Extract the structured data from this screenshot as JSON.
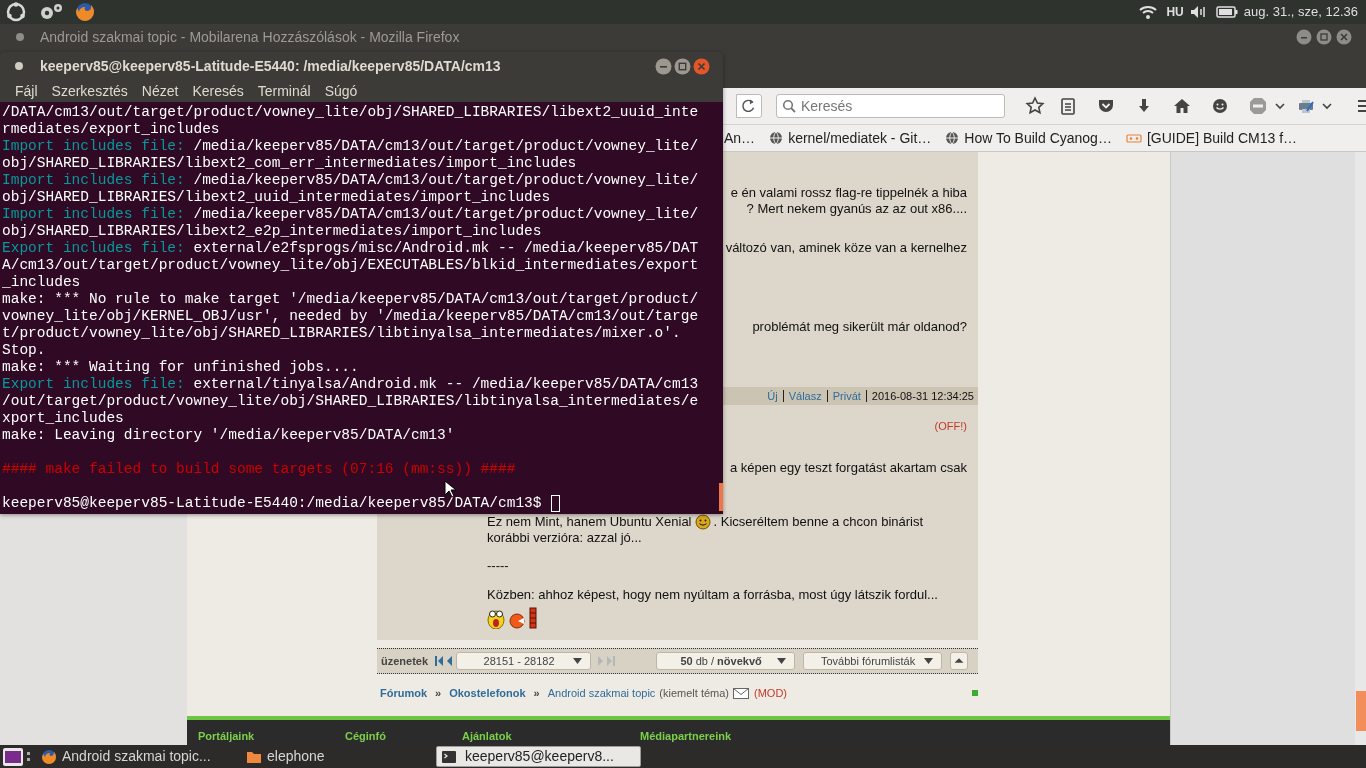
{
  "top_panel": {
    "keyboard_layout": "HU",
    "clock": "aug. 31., sze, 12.36"
  },
  "browser": {
    "title": "Android szakmai topic - Mobilarena Hozzászólások - Mozilla Firefox",
    "search": {
      "placeholder": "Keresés"
    },
    "bookmarks": [
      {
        "label": "An…",
        "kind": "plain"
      },
      {
        "label": "kernel/mediatek - Git…",
        "kind": "globe"
      },
      {
        "label": "How To Build Cyanog…",
        "kind": "globe"
      },
      {
        "label": "[GUIDE] Build CM13 f…",
        "kind": "xda"
      }
    ],
    "posts": [
      {
        "paragraphs": [
          [
            {
              "kind": "text",
              "text": "e én valami rossz flag-re tippelnék a hiba"
            },
            {
              "kind": "text",
              "text": "? Mert nekem gyanús az az out x86...."
            }
          ],
          [
            {
              "kind": "text",
              "text": "változó van, aminek köze van a kernelhez"
            }
          ],
          [
            {
              "kind": "text",
              "text": "problémát meg sikerült már oldanod?"
            }
          ]
        ],
        "footer": {
          "links": [
            "Új",
            "Válasz",
            "Privát"
          ],
          "timestamp": "2016-08-31 12:34:25"
        }
      },
      {
        "badge": "(OFF!)",
        "paragraphs": [
          [
            {
              "kind": "text",
              "text": "a képen egy teszt forgatást akartam csak"
            }
          ],
          [
            {
              "kind": "smiley_text",
              "before": "Ez nem Mint, hanem Ubuntu Xenial",
              "after": ". Kicseréltem benne a chcon binárist"
            },
            {
              "kind": "text",
              "text": "korábbi verzióra: azzal jó..."
            }
          ],
          [
            {
              "kind": "text",
              "text": "-----"
            }
          ],
          [
            {
              "kind": "text",
              "text": "Közben: ahhoz képest, hogy nem nyúltam a forrásba, most úgy látszik fordul..."
            },
            {
              "kind": "emojis"
            }
          ]
        ]
      }
    ],
    "pager": {
      "label": "üzenetek",
      "range": "28151 - 28182",
      "per_page": "**50** db / **növekvő**",
      "more": "További fórumlisták"
    },
    "breadcrumb": [
      {
        "kind": "section",
        "label": "Fórumok"
      },
      {
        "kind": "separator",
        "label": "»"
      },
      {
        "kind": "section",
        "label": "Okostelefonok"
      },
      {
        "kind": "separator",
        "label": "»"
      },
      {
        "kind": "topic",
        "label": "Android szakmai topic"
      },
      {
        "kind": "note",
        "label": "(kiemelt téma)"
      },
      {
        "kind": "mail"
      },
      {
        "kind": "mod",
        "label": "(MOD)"
      }
    ],
    "footer": [
      "Portáljaink",
      "Céginfó",
      "Ajánlatok",
      "Médiapartnereink"
    ]
  },
  "terminal": {
    "title": "keeperv85@keeperv85-Latitude-E5440: /media/keeperv85/DATA/cm13",
    "menu": [
      "Fájl",
      "Szerkesztés",
      "Nézet",
      "Keresés",
      "Terminál",
      "Súgó"
    ],
    "lines": [
      {
        "kind": "output",
        "text": "/DATA/cm13/out/target/product/vowney_lite/obj/SHARED_LIBRARIES/libext2_uuid_inte"
      },
      {
        "kind": "output",
        "text": "rmediates/export_includes"
      },
      {
        "kind": "info",
        "label": "Import includes file:",
        "text": " /media/keeperv85/DATA/cm13/out/target/product/vowney_lite/"
      },
      {
        "kind": "output",
        "text": "obj/SHARED_LIBRARIES/libext2_com_err_intermediates/import_includes"
      },
      {
        "kind": "info",
        "label": "Import includes file:",
        "text": " /media/keeperv85/DATA/cm13/out/target/product/vowney_lite/"
      },
      {
        "kind": "output",
        "text": "obj/SHARED_LIBRARIES/libext2_uuid_intermediates/import_includes"
      },
      {
        "kind": "info",
        "label": "Import includes file:",
        "text": " /media/keeperv85/DATA/cm13/out/target/product/vowney_lite/"
      },
      {
        "kind": "output",
        "text": "obj/SHARED_LIBRARIES/libext2_e2p_intermediates/import_includes"
      },
      {
        "kind": "info",
        "label": "Export includes file:",
        "text": " external/e2fsprogs/misc/Android.mk -- /media/keeperv85/DAT"
      },
      {
        "kind": "output",
        "text": "A/cm13/out/target/product/vowney_lite/obj/EXECUTABLES/blkid_intermediates/export"
      },
      {
        "kind": "output",
        "text": "_includes"
      },
      {
        "kind": "output",
        "text": "make: *** No rule to make target '/media/keeperv85/DATA/cm13/out/target/product/"
      },
      {
        "kind": "output",
        "text": "vowney_lite/obj/KERNEL_OBJ/usr', needed by '/media/keeperv85/DATA/cm13/out/targe"
      },
      {
        "kind": "output",
        "text": "t/product/vowney_lite/obj/SHARED_LIBRARIES/libtinyalsa_intermediates/mixer.o'."
      },
      {
        "kind": "output",
        "text": "Stop."
      },
      {
        "kind": "output",
        "text": "make: *** Waiting for unfinished jobs...."
      },
      {
        "kind": "info",
        "label": "Export includes file:",
        "text": " external/tinyalsa/Android.mk -- /media/keeperv85/DATA/cm13"
      },
      {
        "kind": "output",
        "text": "/out/target/product/vowney_lite/obj/SHARED_LIBRARIES/libtinyalsa_intermediates/e"
      },
      {
        "kind": "output",
        "text": "xport_includes"
      },
      {
        "kind": "output",
        "text": "make: Leaving directory '/media/keeperv85/DATA/cm13'"
      },
      {
        "kind": "blank"
      },
      {
        "kind": "error",
        "text": "#### make failed to build some targets (07:16 (mm:ss)) ####"
      },
      {
        "kind": "blank"
      },
      {
        "kind": "prompt",
        "text": "keeperv85@keeperv85-Latitude-E5440:/media/keeperv85/DATA/cm13$"
      }
    ]
  },
  "taskbar": [
    {
      "kind": "firefox",
      "label": "Android szakmai topic...",
      "selected": false
    },
    {
      "kind": "folder",
      "label": "elephone",
      "selected": false
    },
    {
      "kind": "terminal",
      "label": "keeperv85@keeperv8...",
      "selected": true
    }
  ]
}
